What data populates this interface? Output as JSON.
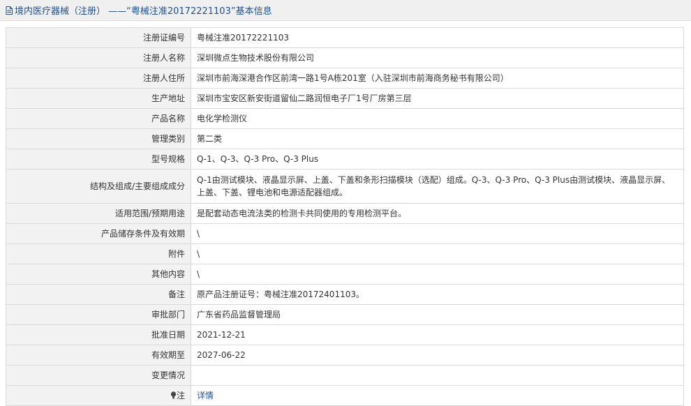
{
  "header": {
    "icon": "document-icon",
    "title": "境内医疗器械（注册） ——“粤械注准20172221103”基本信息"
  },
  "rows": [
    {
      "label": "注册证编号",
      "value": "粤械注准20172221103"
    },
    {
      "label": "注册人名称",
      "value": "深圳微点生物技术股份有限公司"
    },
    {
      "label": "注册人住所",
      "value": "深圳市前海深港合作区前湾一路1号A栋201室（入驻深圳市前海商务秘书有限公司）"
    },
    {
      "label": "生产地址",
      "value": "深圳市宝安区新安街道留仙二路润恒电子厂1号厂房第三层"
    },
    {
      "label": "产品名称",
      "value": "电化学检测仪"
    },
    {
      "label": "管理类别",
      "value": "第二类"
    },
    {
      "label": "型号规格",
      "value": "Q-1、Q-3、Q-3 Pro、Q-3 Plus"
    },
    {
      "label": "结构及组成/主要组成成分",
      "value": "Q-1由测试模块、液晶显示屏、上盖、下盖和条形扫描模块（选配）组成。Q-3、Q-3 Pro、Q-3 Plus由测试模块、液晶显示屏、上盖、下盖、锂电池和电源适配器组成。"
    },
    {
      "label": "适用范围/预期用途",
      "value": "是配套动态电流法类的检测卡共同使用的专用检测平台。"
    },
    {
      "label": "产品储存条件及有效期",
      "value": "\\"
    },
    {
      "label": "附件",
      "value": "\\"
    },
    {
      "label": "其他内容",
      "value": "\\"
    },
    {
      "label": "备注",
      "value": "原产品注册证号：粤械注准20172401103。"
    },
    {
      "label": "审批部门",
      "value": "广东省药品监督管理局"
    },
    {
      "label": "批准日期",
      "value": "2021-12-21"
    },
    {
      "label": "有效期至",
      "value": "2027-06-22"
    },
    {
      "label": "变更情况",
      "value": ""
    }
  ],
  "note": {
    "icon": "lightbulb-icon",
    "label": "注",
    "link": "详情"
  },
  "colors": {
    "title_text": "#1e4f95",
    "link": "#1e4f95",
    "label_bg": "#f2f2f2",
    "border": "#d9d9d9"
  }
}
